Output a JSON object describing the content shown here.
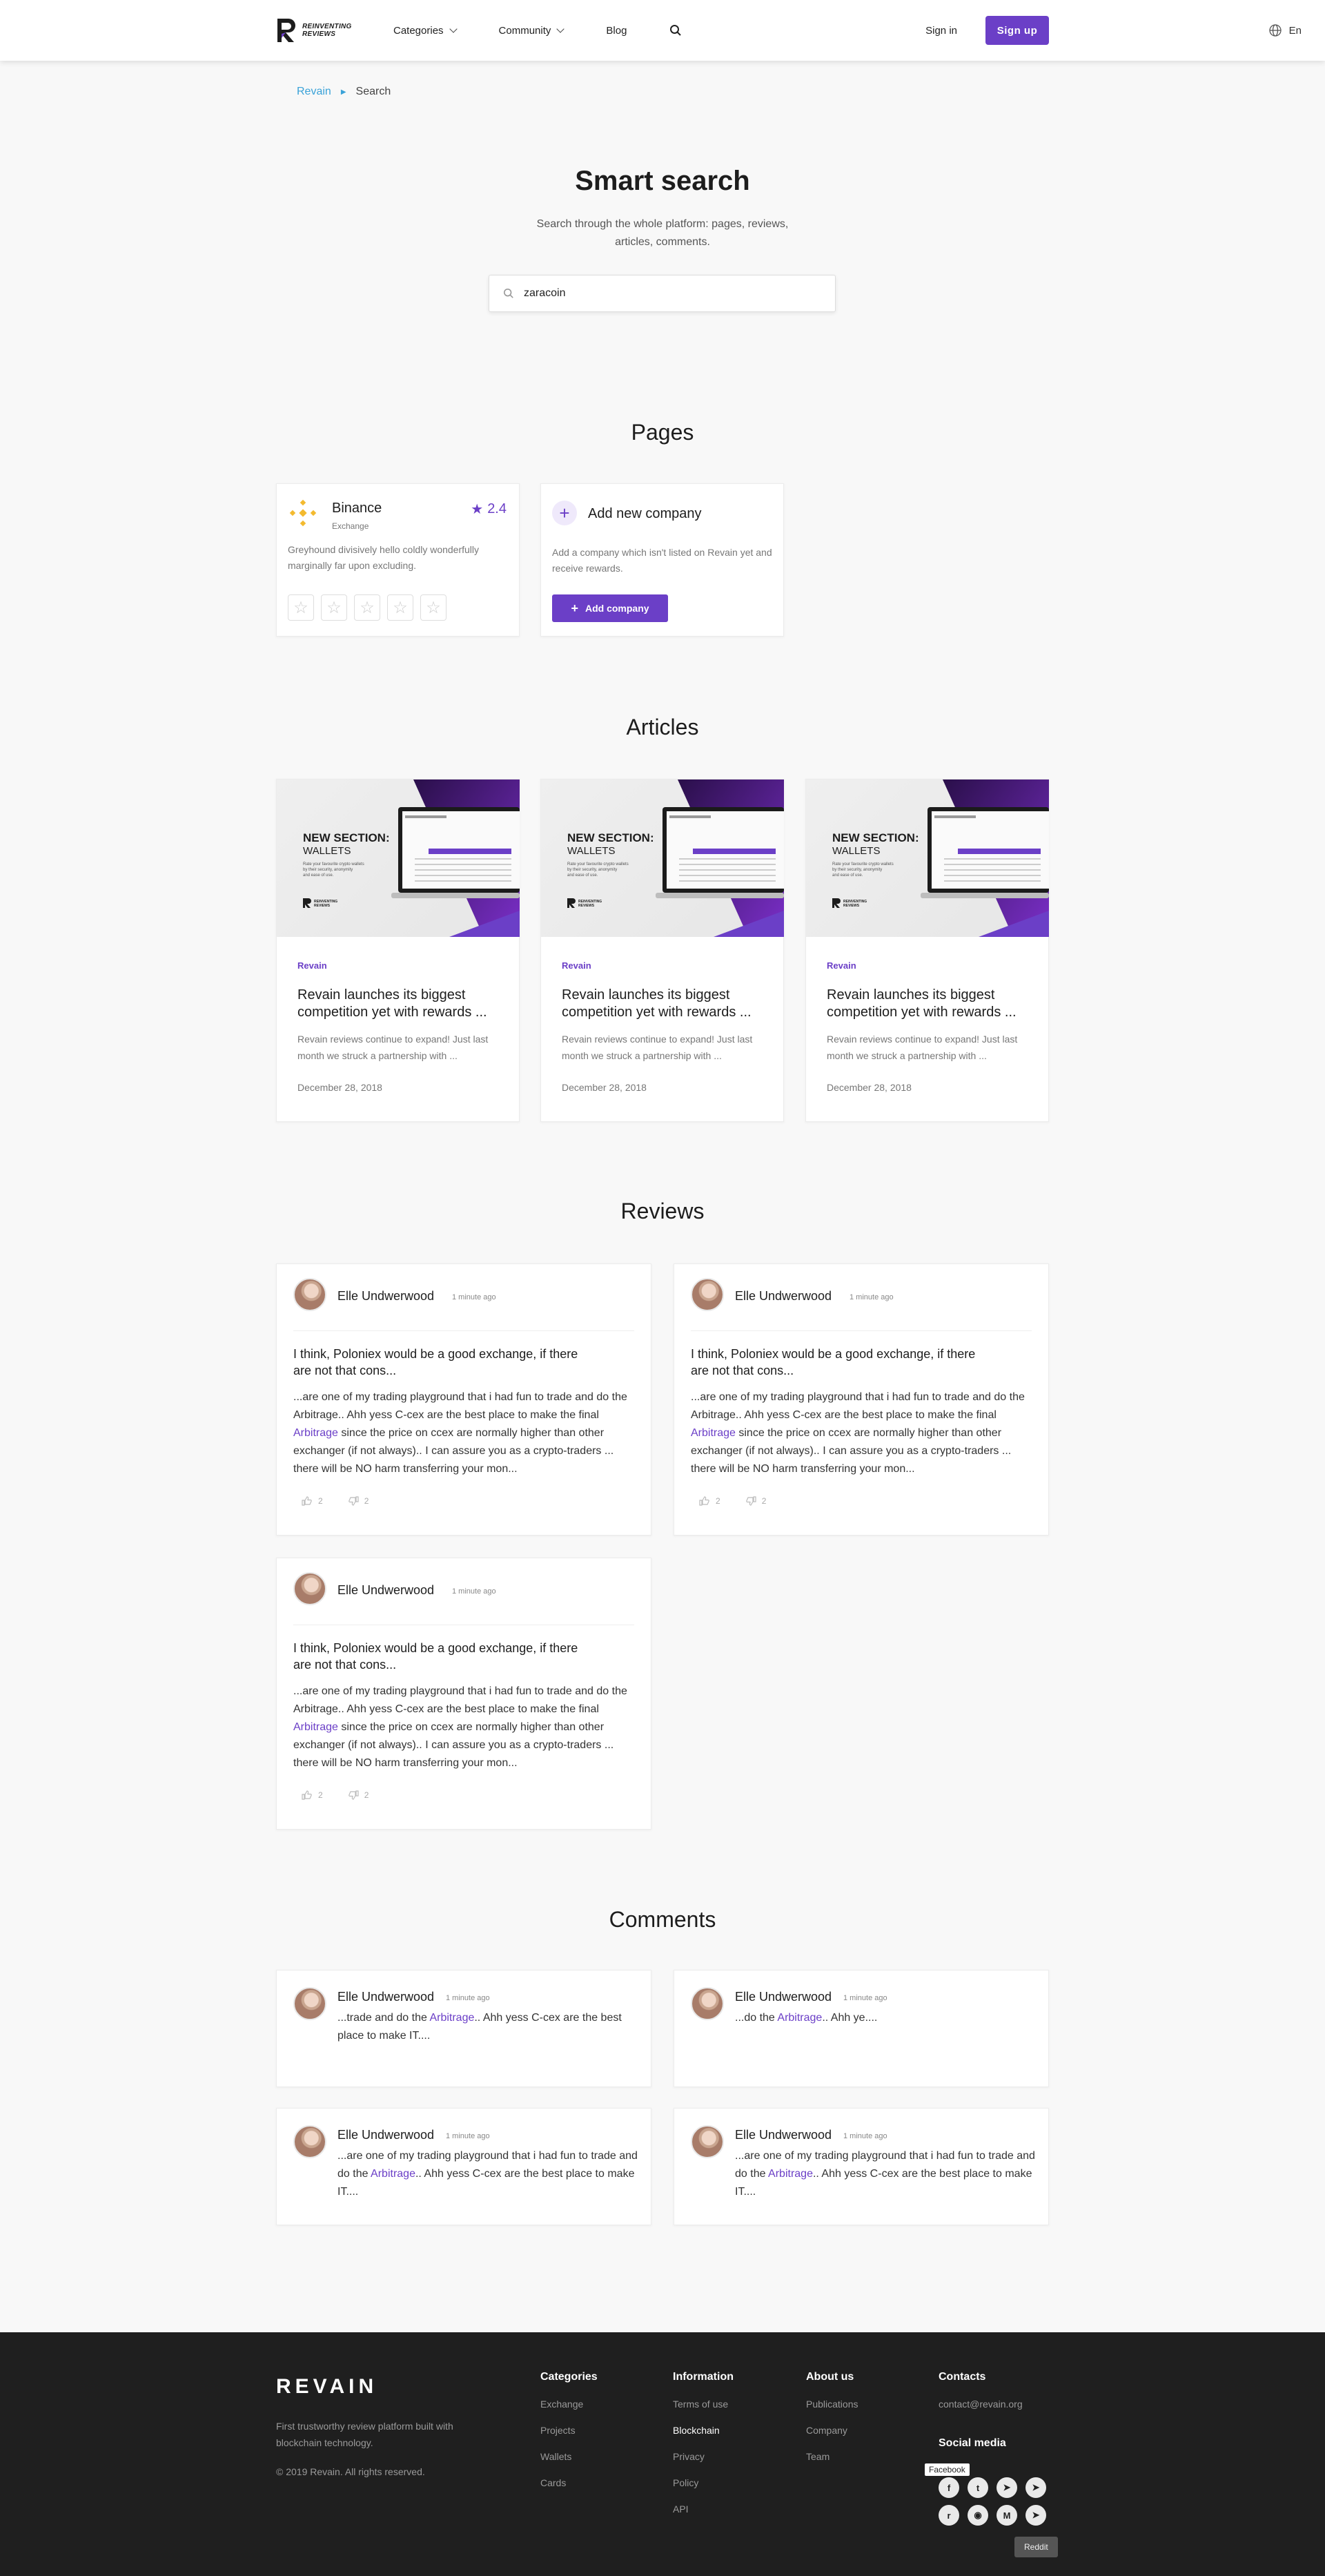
{
  "header": {
    "logo_line1": "REINVENTING",
    "logo_line2": "REVIEWS",
    "nav": [
      {
        "label": "Categories"
      },
      {
        "label": "Community"
      },
      {
        "label": "Blog"
      }
    ],
    "signin": "Sign in",
    "signup": "Sign up",
    "lang": "En"
  },
  "breadcrumb": {
    "root": "Revain",
    "current": "Search"
  },
  "hero": {
    "title": "Smart search",
    "subtitle": "Search through the whole platform: pages, reviews, articles, comments.",
    "search_value": "zaracoin"
  },
  "sections": {
    "pages": "Pages",
    "articles": "Articles",
    "reviews": "Reviews",
    "comments": "Comments"
  },
  "pages": {
    "company": {
      "name": "Binance",
      "category": "Exchange",
      "rating": "2.4",
      "description": "Greyhound divisively hello coldly wonderfully marginally far upon excluding."
    },
    "add": {
      "title": "Add new company",
      "description": "Add a company which isn't listed on Revain yet and receive rewards.",
      "button": "Add company"
    }
  },
  "articles": [
    {
      "img_title": "NEW SECTION:",
      "img_sub": "WALLETS",
      "img_desc": "Rate your favourite crypto wallets by their security, anonymity and ease of use.",
      "tag": "Revain",
      "title": "Revain launches its biggest competition yet with rewards ...",
      "desc": "Revain reviews continue to expand! Just last month we struck a partnership with ...",
      "date": "December 28, 2018"
    },
    {
      "img_title": "NEW SECTION:",
      "img_sub": "WALLETS",
      "img_desc": "Rate your favourite crypto wallets by their security, anonymity and ease of use.",
      "tag": "Revain",
      "title": "Revain launches its biggest competition yet with rewards ...",
      "desc": "Revain reviews continue to expand! Just last month we struck a partnership with ...",
      "date": "December 28, 2018"
    },
    {
      "img_title": "NEW SECTION:",
      "img_sub": "WALLETS",
      "img_desc": "Rate your favourite crypto wallets by their security, anonymity and ease of use.",
      "tag": "Revain",
      "title": "Revain launches its biggest competition yet with rewards ...",
      "desc": "Revain reviews continue to expand! Just last month we struck a partnership with ...",
      "date": "December 28, 2018"
    }
  ],
  "reviews": [
    {
      "author": "Elle Undwerwood",
      "time": "1 minute ago",
      "title": "I think, Poloniex would be a good exchange, if there are not that cons...",
      "text_before": "...are one of my trading playground that i had fun to trade and do the Arbitrage.. Ahh yess C-cex are the best place to make the final ",
      "highlight": "Arbitrage",
      "text_after": " since the price on ccex are normally higher than other exchanger (if not always).. I can assure you as a crypto-traders ... there will be NO harm transferring your mon...",
      "likes": "2",
      "dislikes": "2"
    },
    {
      "author": "Elle Undwerwood",
      "time": "1 minute ago",
      "title": "I think, Poloniex would be a good exchange, if there are not that cons...",
      "text_before": "...are one of my trading playground that i had fun to trade and do the Arbitrage.. Ahh yess C-cex are the best place to make the final ",
      "highlight": "Arbitrage",
      "text_after": " since the price on ccex are normally higher than other exchanger (if not always).. I can assure you as a crypto-traders ... there will be NO harm transferring your mon...",
      "likes": "2",
      "dislikes": "2"
    },
    {
      "author": "Elle Undwerwood",
      "time": "1 minute ago",
      "title": "I think, Poloniex would be a good exchange, if there are not that cons...",
      "text_before": "...are one of my trading playground that i had fun to trade and do the Arbitrage.. Ahh yess C-cex are the best place to make the final ",
      "highlight": "Arbitrage",
      "text_after": " since the price on ccex are normally higher than other exchanger (if not always).. I can assure you as a crypto-traders ... there will be NO harm transferring your mon...",
      "likes": "2",
      "dislikes": "2"
    }
  ],
  "comments": [
    {
      "author": "Elle Undwerwood",
      "time": "1 minute ago",
      "before": "...trade and do the ",
      "highlight": "Arbitrage",
      "after": ".. Ahh yess C-cex are the best place to make IT...."
    },
    {
      "author": "Elle Undwerwood",
      "time": "1 minute ago",
      "before": "...do the ",
      "highlight": "Arbitrage",
      "after": ".. Ahh ye...."
    },
    {
      "author": "Elle Undwerwood",
      "time": "1 minute ago",
      "before": "...are one of my trading playground that i had fun to trade and do the ",
      "highlight": "Arbitrage",
      "after": ".. Ahh yess C-cex are the best place to make IT...."
    },
    {
      "author": "Elle Undwerwood",
      "time": "1 minute ago",
      "before": "...are one of my trading playground that i had fun to trade and do the ",
      "highlight": "Arbitrage",
      "after": ".. Ahh yess C-cex are the best place to make IT...."
    }
  ],
  "footer": {
    "logo": "REVAIN",
    "desc": "First trustworthy review platform built with blockchain technology.",
    "copyright": "© 2019 Revain. All rights reserved.",
    "categories": {
      "title": "Categories",
      "links": [
        "Exchange",
        "Projects",
        "Wallets",
        "Cards"
      ]
    },
    "information": {
      "title": "Information",
      "links": [
        "Terms of use",
        "Blockchain",
        "Privacy",
        "Policy",
        "API"
      ]
    },
    "about": {
      "title": "About us",
      "links": [
        "Publications",
        "Company",
        "Team"
      ]
    },
    "contacts": {
      "title": "Contacts",
      "email": "contact@revain.org"
    },
    "social_title": "Social media",
    "tooltip_facebook": "Facebook",
    "tooltip_reddit": "Reddit"
  },
  "colors": {
    "accent": "#6b3fc7",
    "link": "#3aa2d8",
    "footer_bg": "#1f1f1f",
    "binance": "#f3ba2f"
  }
}
